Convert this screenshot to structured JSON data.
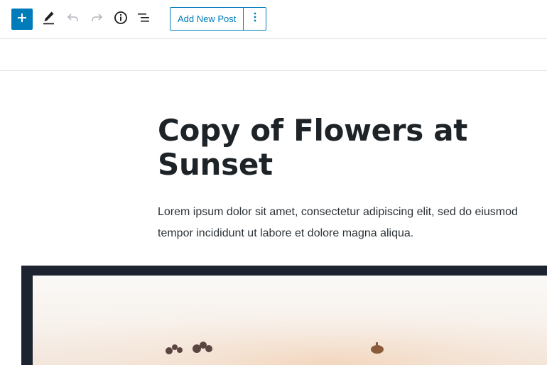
{
  "toolbar": {
    "add_new_post_label": "Add New Post",
    "icons": [
      "plus-icon",
      "pencil-icon",
      "undo-icon",
      "redo-icon",
      "info-icon",
      "list-view-icon",
      "more-vertical-icon"
    ],
    "accent_color": "#007cba"
  },
  "post": {
    "title": "Copy of Flowers at Sunset",
    "paragraph": "Lorem ipsum dolor sit amet, consectetur adipiscing elit, sed do eiusmod tempor incididunt ut labore et dolore magna aliqua."
  }
}
